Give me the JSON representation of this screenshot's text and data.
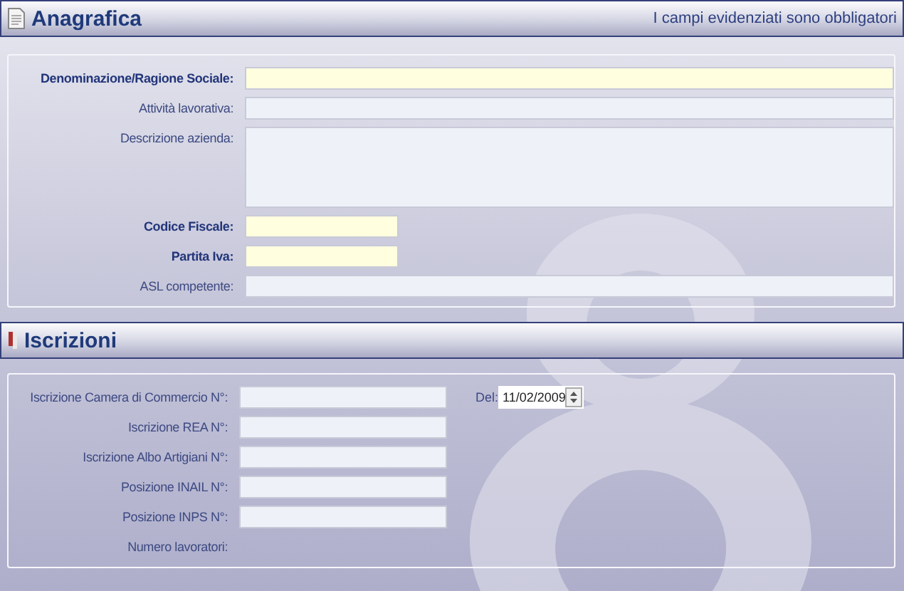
{
  "sections": [
    {
      "title": "Anagrafica",
      "note": "I campi evidenziati sono obbligatori",
      "fields": [
        {
          "label": "Denominazione/Ragione Sociale:",
          "required": true,
          "kind": "wide"
        },
        {
          "label": "Attività lavorativa:",
          "required": false,
          "kind": "wide"
        },
        {
          "label": "Descrizione azienda:",
          "required": false,
          "kind": "multiline"
        },
        {
          "label": "Codice Fiscale:",
          "required": true,
          "kind": "short"
        },
        {
          "label": "Partita Iva:",
          "required": true,
          "kind": "short"
        },
        {
          "label": "ASL competente:",
          "required": false,
          "kind": "wide"
        }
      ]
    },
    {
      "title": "Iscrizioni",
      "fields": [
        {
          "label": "Iscrizione Camera di Commercio N°:",
          "required": false,
          "kind": "medium",
          "date": {
            "label": "Del:",
            "value": "11/02/2009"
          }
        },
        {
          "label": "Iscrizione REA N°:",
          "required": false,
          "kind": "medium"
        },
        {
          "label": "Iscrizione Albo Artigiani N°:",
          "required": false,
          "kind": "medium"
        },
        {
          "label": "Posizione INAIL N°:",
          "required": false,
          "kind": "medium"
        },
        {
          "label": "Posizione INPS N°:",
          "required": false,
          "kind": "medium"
        },
        {
          "label": "Numero lavoratori:",
          "required": false,
          "kind": "none"
        }
      ]
    }
  ]
}
